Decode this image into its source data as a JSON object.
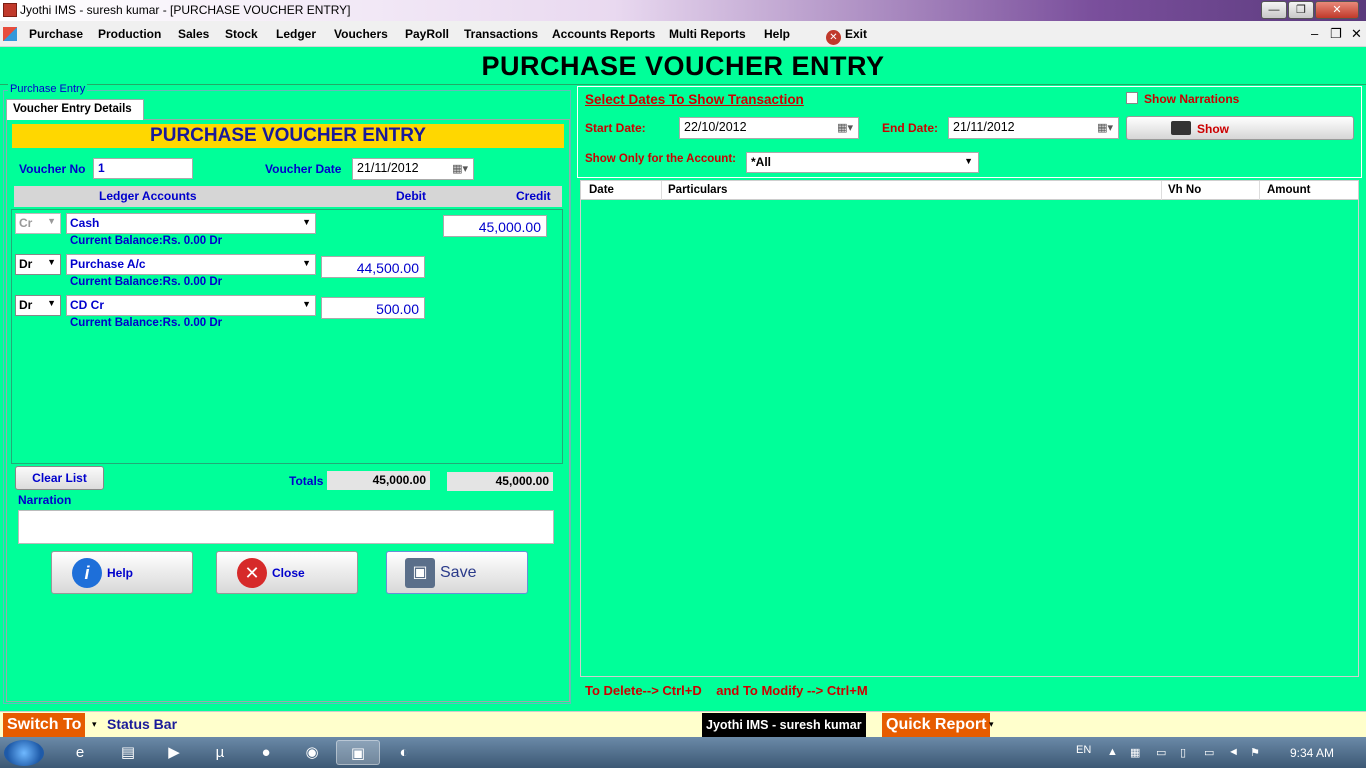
{
  "window": {
    "title": "Jyothi IMS - suresh kumar - [PURCHASE VOUCHER ENTRY]",
    "min": "—",
    "restore": "❐",
    "close": "✕"
  },
  "menu": {
    "items": [
      "Purchase",
      "Production",
      "Sales",
      "Stock",
      "Ledger",
      "Vouchers",
      "PayRoll",
      "Transactions",
      "Accounts Reports",
      "Multi Reports",
      "Help"
    ],
    "exit_label": "Exit",
    "mdi_min": "–",
    "mdi_restore": "❐",
    "mdi_close": "✕"
  },
  "header": {
    "title": "PURCHASE VOUCHER ENTRY"
  },
  "left": {
    "group_label": "Purchase Entry",
    "tab_label": "Voucher Entry Details",
    "panel_title": "PURCHASE VOUCHER ENTRY",
    "voucher_no_label": "Voucher No",
    "voucher_no": "1",
    "voucher_date_label": "Voucher Date",
    "voucher_date": "21/11/2012",
    "grid_headers": {
      "ledger": "Ledger Accounts",
      "debit": "Debit",
      "credit": "Credit"
    },
    "rows": [
      {
        "drcr": "Cr",
        "account": "Cash",
        "debit": "",
        "credit": "45,000.00",
        "balance": "Current Balance:Rs. 0.00 Dr"
      },
      {
        "drcr": "Dr",
        "account": "Purchase A/c",
        "debit": "44,500.00",
        "credit": "",
        "balance": "Current Balance:Rs. 0.00 Dr"
      },
      {
        "drcr": "Dr",
        "account": "CD Cr",
        "debit": "500.00",
        "credit": "",
        "balance": "Current Balance:Rs. 0.00 Dr"
      }
    ],
    "clear_list": "Clear List",
    "totals_label": "Totals",
    "total_debit": "45,000.00",
    "total_credit": "45,000.00",
    "narration_label": "Narration",
    "buttons": {
      "help": "Help",
      "close": "Close",
      "save": "Save"
    }
  },
  "right": {
    "select_dates": "Select Dates To Show Transaction",
    "show_narrations": "Show Narrations",
    "start_date_label": "Start Date:",
    "start_date": "22/10/2012",
    "end_date_label": "End Date:",
    "end_date": "21/11/2012",
    "show_button": "Show",
    "account_filter_label": "Show Only for the Account:",
    "account_filter": "*All",
    "list_headers": [
      "Date",
      "Particulars",
      "Vh No",
      "Amount"
    ],
    "hint": "To Delete--> Ctrl+D    and To Modify --> Ctrl+M"
  },
  "statusbar": {
    "switch_to": "Switch To",
    "status": "Status Bar",
    "user": "Jyothi IMS - suresh kumar",
    "quick_report": "Quick Report"
  },
  "taskbar": {
    "lang": "EN",
    "time": "9:34 AM"
  }
}
